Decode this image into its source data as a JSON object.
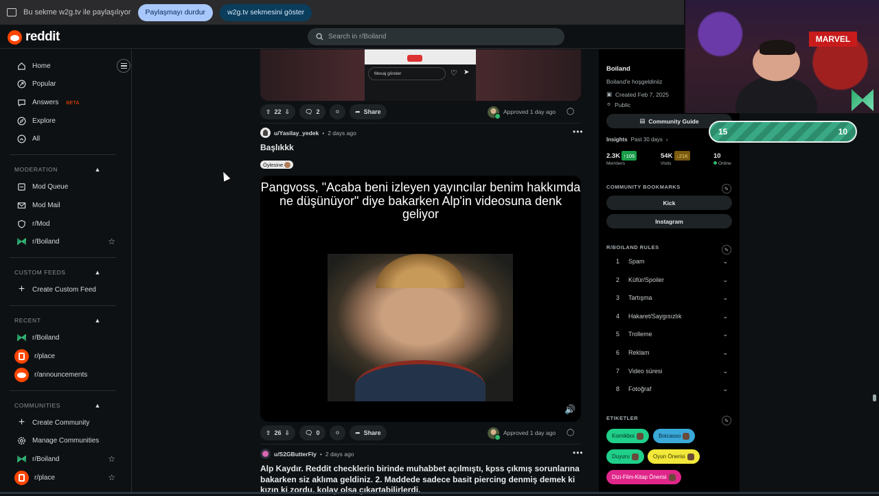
{
  "share_bar": {
    "message": "Bu sekme w2g.tv ile paylaşılıyor",
    "stop_label": "Paylaşmayı durdur",
    "show_label": "w2g.tv sekmesini göster"
  },
  "header": {
    "logo_text": "reddit",
    "search_placeholder": "Search in r/Boiland"
  },
  "sidebar": {
    "main": [
      {
        "label": "Home",
        "icon": "home-icon"
      },
      {
        "label": "Popular",
        "icon": "popular-icon"
      },
      {
        "label": "Answers",
        "icon": "answers-icon",
        "badge": "BETA"
      },
      {
        "label": "Explore",
        "icon": "explore-icon"
      },
      {
        "label": "All",
        "icon": "all-icon"
      }
    ],
    "moderation_title": "MODERATION",
    "moderation": [
      {
        "label": "Mod Queue"
      },
      {
        "label": "Mod Mail"
      },
      {
        "label": "r/Mod"
      },
      {
        "label": "r/Boiland"
      }
    ],
    "custom_feeds_title": "CUSTOM FEEDS",
    "create_custom_feed": "Create Custom Feed",
    "recent_title": "RECENT",
    "recent": [
      {
        "label": "r/Boiland"
      },
      {
        "label": "r/place"
      },
      {
        "label": "r/announcements"
      }
    ],
    "communities_title": "COMMUNITIES",
    "communities": [
      {
        "label": "Create Community"
      },
      {
        "label": "Manage Communities"
      },
      {
        "label": "r/Boiland"
      },
      {
        "label": "r/place"
      }
    ]
  },
  "feed": {
    "phone_input": "Mesaj gönder",
    "post1": {
      "votes": "22",
      "comments": "2",
      "share": "Share",
      "approved": "Approved 1 day ago"
    },
    "post2": {
      "author": "u/Yasilay_yedek",
      "time": "2 days ago",
      "title": "Başlıkkk",
      "flair": "Öylesine",
      "meme_text": "Pangvoss, \"Acaba beni izleyen yayıncılar benim hakkımda ne düşünüyor\" diye bakarken Alp'in videosuna denk geliyor",
      "votes": "26",
      "comments": "0",
      "share": "Share",
      "approved": "Approved 1 day ago"
    },
    "post3": {
      "author": "u/S2GButterFly",
      "time": "2 days ago",
      "text": "Alp Kaydır. Reddit checklerin birinde muhabbet açılmıştı, kpss çıkmış sorunlarına bakarken siz aklıma geldiniz. 2. Maddede sadece basit piercing denmiş demek ki kızın ki zordu, kolay olsa çıkartabilirlerdi."
    }
  },
  "right": {
    "community_name": "Boiland",
    "welcome": "Boiland'e hoşgeldiniiz",
    "created": "Created Feb 7, 2025",
    "visibility": "Public",
    "guide_button": "Community Guide",
    "insights_label": "Insights",
    "insights_period": "Past 30 days",
    "members_num": "2.3K",
    "members_badge": "↑105",
    "members_label": "Members",
    "visits_num": "54K",
    "visits_badge": "↓21K",
    "visits_label": "Visits",
    "online_num": "10",
    "online_label": "Online",
    "bookmarks_title": "COMMUNITY BOOKMARKS",
    "bookmarks": [
      "Kick",
      "Instagram"
    ],
    "rules_title": "R/BOILAND RULES",
    "rules": [
      {
        "n": "1",
        "t": "Spam"
      },
      {
        "n": "2",
        "t": "Küfür/Spoiler"
      },
      {
        "n": "3",
        "t": "Tartışma"
      },
      {
        "n": "4",
        "t": "Hakaret/Saygısızlık"
      },
      {
        "n": "5",
        "t": "Trolleme"
      },
      {
        "n": "6",
        "t": "Reklam"
      },
      {
        "n": "7",
        "t": "Video süresi"
      },
      {
        "n": "8",
        "t": "Fotoğraf"
      }
    ],
    "tags_title": "ETIKETLER",
    "tags": [
      "Komikboi",
      "Boicasso",
      "Duyuru",
      "Oyun Önerisi",
      "Dizi-Film-Kitap Önerisi"
    ]
  },
  "overlay": {
    "score_left": "15",
    "score_right": "10",
    "marvel_text": "MARVEL"
  },
  "colors": {
    "accent": "#ff4500",
    "bg": "#0e1113",
    "tag_green": "#1fcf8a",
    "tag_blue": "#3aa9d9",
    "tag_yellow": "#f2e83a",
    "tag_pink": "#e0268a"
  }
}
